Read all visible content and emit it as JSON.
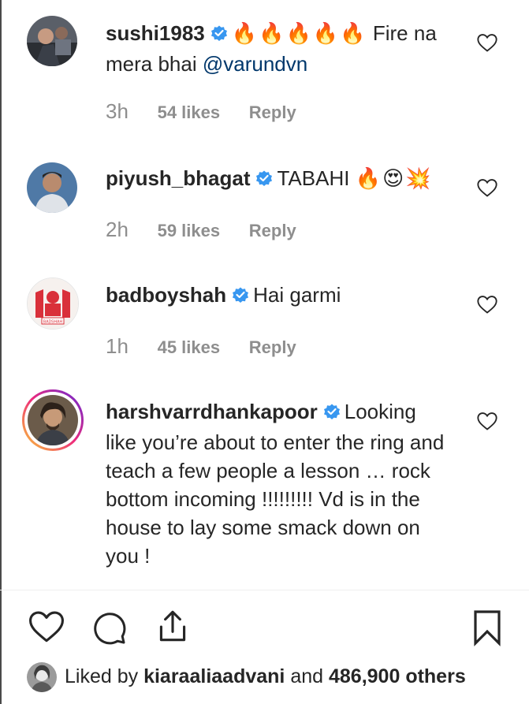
{
  "comments": [
    {
      "username": "sushi1983",
      "emoji": "🔥🔥🔥🔥🔥",
      "text": "Fire na",
      "text2": "mera bhai",
      "mention": "@varundvn",
      "time": "3h",
      "likes": "54 likes",
      "reply": "Reply"
    },
    {
      "username": "piyush_bhagat",
      "text": "TABAHI",
      "emoji": "🔥😍💥",
      "time": "2h",
      "likes": "59 likes",
      "reply": "Reply"
    },
    {
      "username": "badboyshah",
      "text": "Hai garmi",
      "time": "1h",
      "likes": "45 likes",
      "reply": "Reply",
      "avatar_text": "BADSHAH"
    },
    {
      "username": "harshvarrdhankapoor",
      "text_first": "Looking",
      "text_rest": "like you’re about to enter the ring and teach a few people a lesson … rock bottom incoming !!!!!!!!! Vd is in the house to lay some smack down on you !"
    }
  ],
  "liked_by": {
    "prefix": "Liked by",
    "user": "kiaraaliaadvani",
    "middle": "and",
    "count": "486,900 others"
  },
  "colors": {
    "verified": "#3897f0",
    "link": "#00376b",
    "muted": "#8e8e8e",
    "text": "#262626"
  },
  "icons": [
    "heart-icon",
    "comment-icon",
    "share-icon",
    "bookmark-icon",
    "verified-badge-icon"
  ]
}
